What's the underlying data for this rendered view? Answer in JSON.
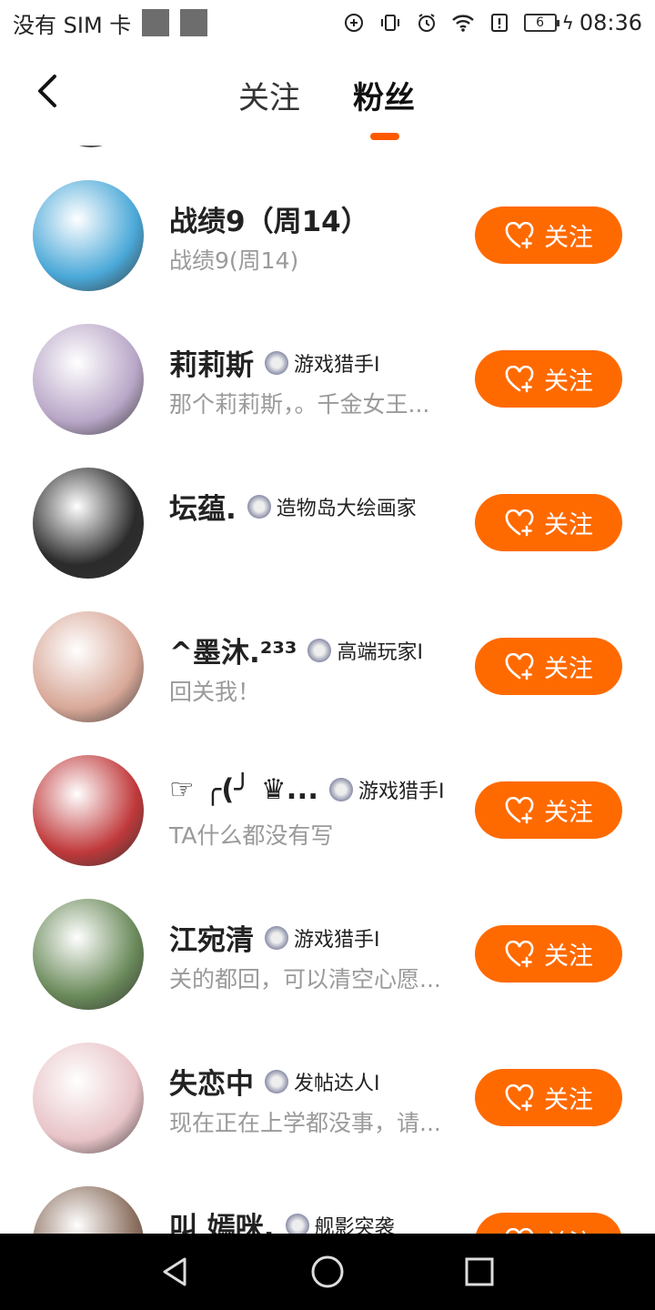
{
  "status_bar": {
    "carrier": "没有 SIM 卡",
    "battery": "6",
    "time": "08:36"
  },
  "header": {
    "tabs": [
      "关注",
      "粉丝"
    ],
    "active_tab": "粉丝"
  },
  "colors": {
    "accent": "#ff6a00",
    "underline": "#ff5a00",
    "desc_gray": "#9a9a9a"
  },
  "follow_label": "关注",
  "users": [
    {
      "name": "战绩9（周14）",
      "badge": "",
      "desc": "战绩9(周14)",
      "avatar_color": "#4aa8d8"
    },
    {
      "name": "莉莉斯",
      "badge": "游戏猎手I",
      "desc": "那个莉莉斯，。千金女王...",
      "avatar_color": "#b9a7c8"
    },
    {
      "name": "坛蕴.",
      "badge": "造物岛大绘画家",
      "desc": "",
      "avatar_color": "#2b2b2b"
    },
    {
      "name": "^墨沐.²³³",
      "badge": "高端玩家I",
      "desc": "回关我！",
      "avatar_color": "#d8a898"
    },
    {
      "name": "☞ ╭(╯ ♛...",
      "badge": "游戏猎手I",
      "desc": "TA什么都没有写",
      "avatar_color": "#c0393b"
    },
    {
      "name": "江宛清",
      "badge": "游戏猎手I",
      "desc": "关的都回，可以清空心愿...",
      "avatar_color": "#6a8a5a"
    },
    {
      "name": "失恋中",
      "badge": "发帖达人I",
      "desc": "现在正在上学都没事，请...",
      "avatar_color": "#e8c4c8"
    },
    {
      "name": "叫 嫣咪.",
      "badge": "舰影突袭",
      "desc": "",
      "avatar_color": "#8a6e5e"
    }
  ]
}
